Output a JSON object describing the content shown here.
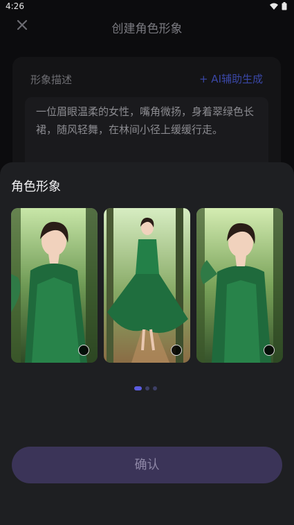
{
  "status_bar": {
    "time": "4:26"
  },
  "header": {
    "title": "创建角色形象"
  },
  "description": {
    "label": "形象描述",
    "ai_button": "+ AI辅助生成",
    "text": "一位眉眼温柔的女性，嘴角微扬，身着翠绿色长裙，随风轻舞，在林间小径上缓缓行走。"
  },
  "sheet": {
    "title": "角色形象",
    "images": [
      {
        "icon": "character-portrait-1"
      },
      {
        "icon": "character-portrait-2"
      },
      {
        "icon": "character-portrait-3"
      }
    ],
    "pagination": {
      "current": 1,
      "total": 3
    },
    "confirm_label": "确认"
  },
  "colors": {
    "accent": "#5b5ce0",
    "confirm_bg": "#3b3458",
    "ai_link": "#3a47a6",
    "sheet_bg": "#1e1f22"
  }
}
